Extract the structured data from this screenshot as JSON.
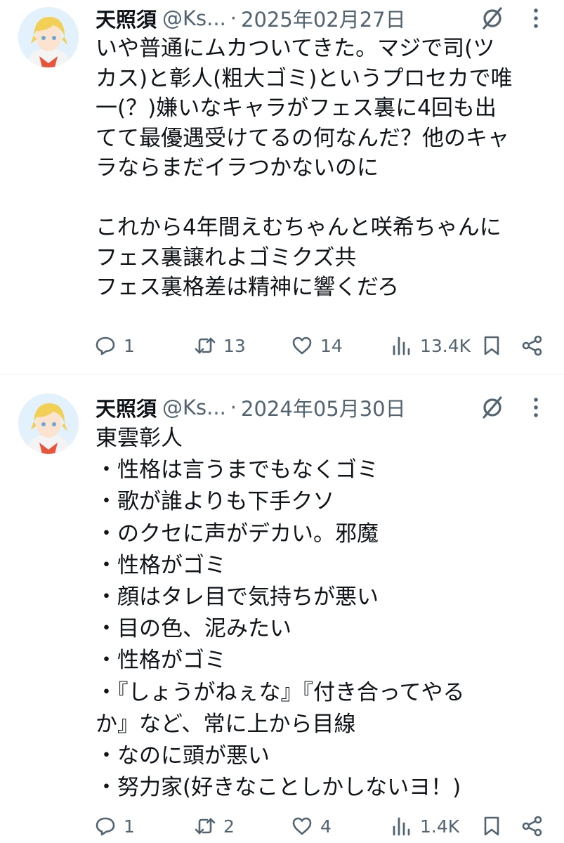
{
  "tweets": [
    {
      "display_name": "天照須",
      "handle": "@Ks...",
      "separator": "·",
      "date": "2025年02月27日",
      "lines": [
        "いや普通にムカついてきた。マジで司(ツ",
        "カス)と彰人(粗大ゴミ)というプロセカで唯",
        "一(？)嫌いなキャラがフェス裏に4回も出",
        "てて最優遇受けてるの何なんだ？他のキャ",
        "ラならまだイラつかないのに",
        "",
        "これから4年間えむちゃんと咲希ちゃんに",
        "フェス裏譲れよゴミクズ共",
        "フェス裏格差は精神に響くだろ"
      ],
      "replies": "1",
      "retweets": "13",
      "likes": "14",
      "views": "13.4K"
    },
    {
      "display_name": "天照須",
      "handle": "@Ks...",
      "separator": "·",
      "date": "2024年05月30日",
      "lines": [
        "東雲彰人",
        "・性格は言うまでもなくゴミ",
        "・歌が誰よりも下手クソ",
        "・のクセに声がデカい。邪魔",
        "・性格がゴミ",
        "・顔はタレ目で気持ちが悪い",
        "・目の色、泥みたい",
        "・性格がゴミ",
        "・『しょうがねぇな』『付き合ってやる",
        "か』など、常に上から目線",
        "・なのに頭が悪い",
        "・努力家(好きなことしかしないヨ！)"
      ],
      "replies": "1",
      "retweets": "2",
      "likes": "4",
      "views": "1.4K"
    }
  ],
  "colors": {
    "text": "#0f1419",
    "secondary": "#536471",
    "divider": "#eff3f4"
  }
}
